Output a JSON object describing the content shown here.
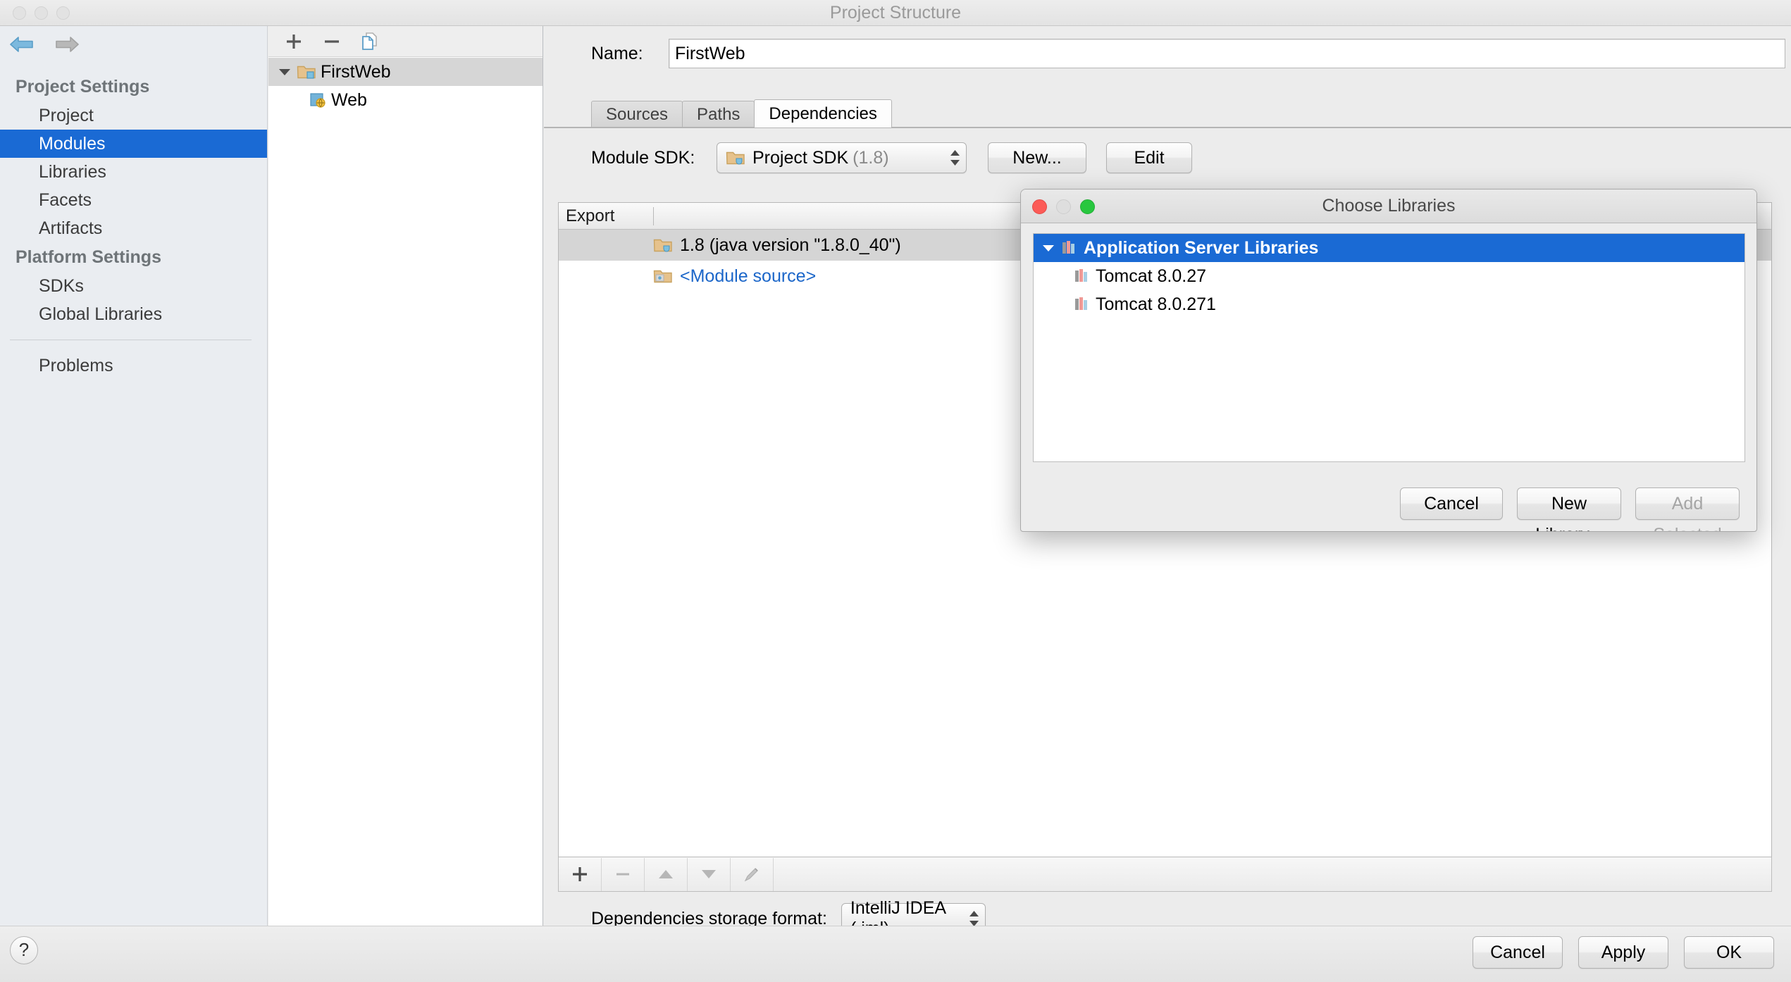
{
  "window": {
    "title": "Project Structure",
    "traffic_lights": [
      "close",
      "minimize",
      "maximize"
    ]
  },
  "sidebar": {
    "nav": {
      "back_icon": "arrow-left-icon",
      "forward_icon": "arrow-right-icon"
    },
    "groups": [
      {
        "title": "Project Settings",
        "items": [
          {
            "label": "Project",
            "selected": false
          },
          {
            "label": "Modules",
            "selected": true
          },
          {
            "label": "Libraries",
            "selected": false
          },
          {
            "label": "Facets",
            "selected": false
          },
          {
            "label": "Artifacts",
            "selected": false
          }
        ]
      },
      {
        "title": "Platform Settings",
        "items": [
          {
            "label": "SDKs",
            "selected": false
          },
          {
            "label": "Global Libraries",
            "selected": false
          }
        ]
      }
    ],
    "problems": {
      "label": "Problems"
    }
  },
  "tree_panel": {
    "toolbar": [
      {
        "name": "add-module-button",
        "icon": "plus-icon"
      },
      {
        "name": "remove-module-button",
        "icon": "minus-icon"
      },
      {
        "name": "copy-module-button",
        "icon": "copy-icon"
      }
    ],
    "nodes": [
      {
        "label": "FirstWeb",
        "icon": "module-folder-icon",
        "level": 0,
        "expanded": true,
        "selected": true
      },
      {
        "label": "Web",
        "icon": "web-facet-icon",
        "level": 1,
        "expanded": false,
        "selected": false
      }
    ]
  },
  "module": {
    "name_label": "Name:",
    "name_value": "FirstWeb",
    "tabs": [
      {
        "label": "Sources",
        "active": false
      },
      {
        "label": "Paths",
        "active": false
      },
      {
        "label": "Dependencies",
        "active": true
      }
    ],
    "sdk": {
      "label": "Module SDK:",
      "value": "Project SDK",
      "value_suffix": "(1.8)",
      "new_button": "New...",
      "edit_button": "Edit"
    },
    "dependencies": {
      "columns": [
        "Export",
        ""
      ],
      "rows": [
        {
          "name": "1.8 (java version \"1.8.0_40\")",
          "icon": "jdk-folder-icon",
          "export": false,
          "selected": true,
          "link": false
        },
        {
          "name": "<Module source>",
          "icon": "module-source-icon",
          "export": false,
          "selected": false,
          "link": true
        }
      ],
      "toolbar": [
        {
          "name": "add-dependency-button",
          "icon": "plus-icon",
          "enabled": true
        },
        {
          "name": "remove-dependency-button",
          "icon": "minus-icon",
          "enabled": false
        },
        {
          "name": "move-up-button",
          "icon": "arrow-up-icon",
          "enabled": false
        },
        {
          "name": "move-down-button",
          "icon": "arrow-down-icon",
          "enabled": false
        },
        {
          "name": "edit-dependency-button",
          "icon": "pencil-icon",
          "enabled": false
        }
      ]
    },
    "storage": {
      "label": "Dependencies storage format:",
      "value": "IntelliJ IDEA (.iml)"
    }
  },
  "footer": {
    "help_label": "?",
    "buttons": [
      {
        "label": "Cancel",
        "name": "cancel-button"
      },
      {
        "label": "Apply",
        "name": "apply-button"
      },
      {
        "label": "OK",
        "name": "ok-button"
      }
    ]
  },
  "modal": {
    "title": "Choose Libraries",
    "traffic_lights": {
      "close": "#fc5b57",
      "minimize": "#dedede",
      "maximize": "#28c73f"
    },
    "tree": [
      {
        "label": "Application Server Libraries",
        "level": 0,
        "expanded": true,
        "selected": true,
        "icon": "library-icon"
      },
      {
        "label": "Tomcat 8.0.27",
        "level": 1,
        "expanded": false,
        "selected": false,
        "icon": "library-icon"
      },
      {
        "label": "Tomcat 8.0.271",
        "level": 1,
        "expanded": false,
        "selected": false,
        "icon": "library-icon"
      }
    ],
    "buttons": [
      {
        "label": "Cancel",
        "name": "modal-cancel-button",
        "enabled": true
      },
      {
        "label": "New Library...",
        "name": "new-library-button",
        "enabled": true
      },
      {
        "label": "Add Selected",
        "name": "add-selected-button",
        "enabled": false
      }
    ]
  },
  "colors": {
    "selection_blue": "#1a6ad4",
    "link_blue": "#1b66c9",
    "row_selected_gray": "#d5d5d5",
    "window_bg": "#ececec"
  }
}
